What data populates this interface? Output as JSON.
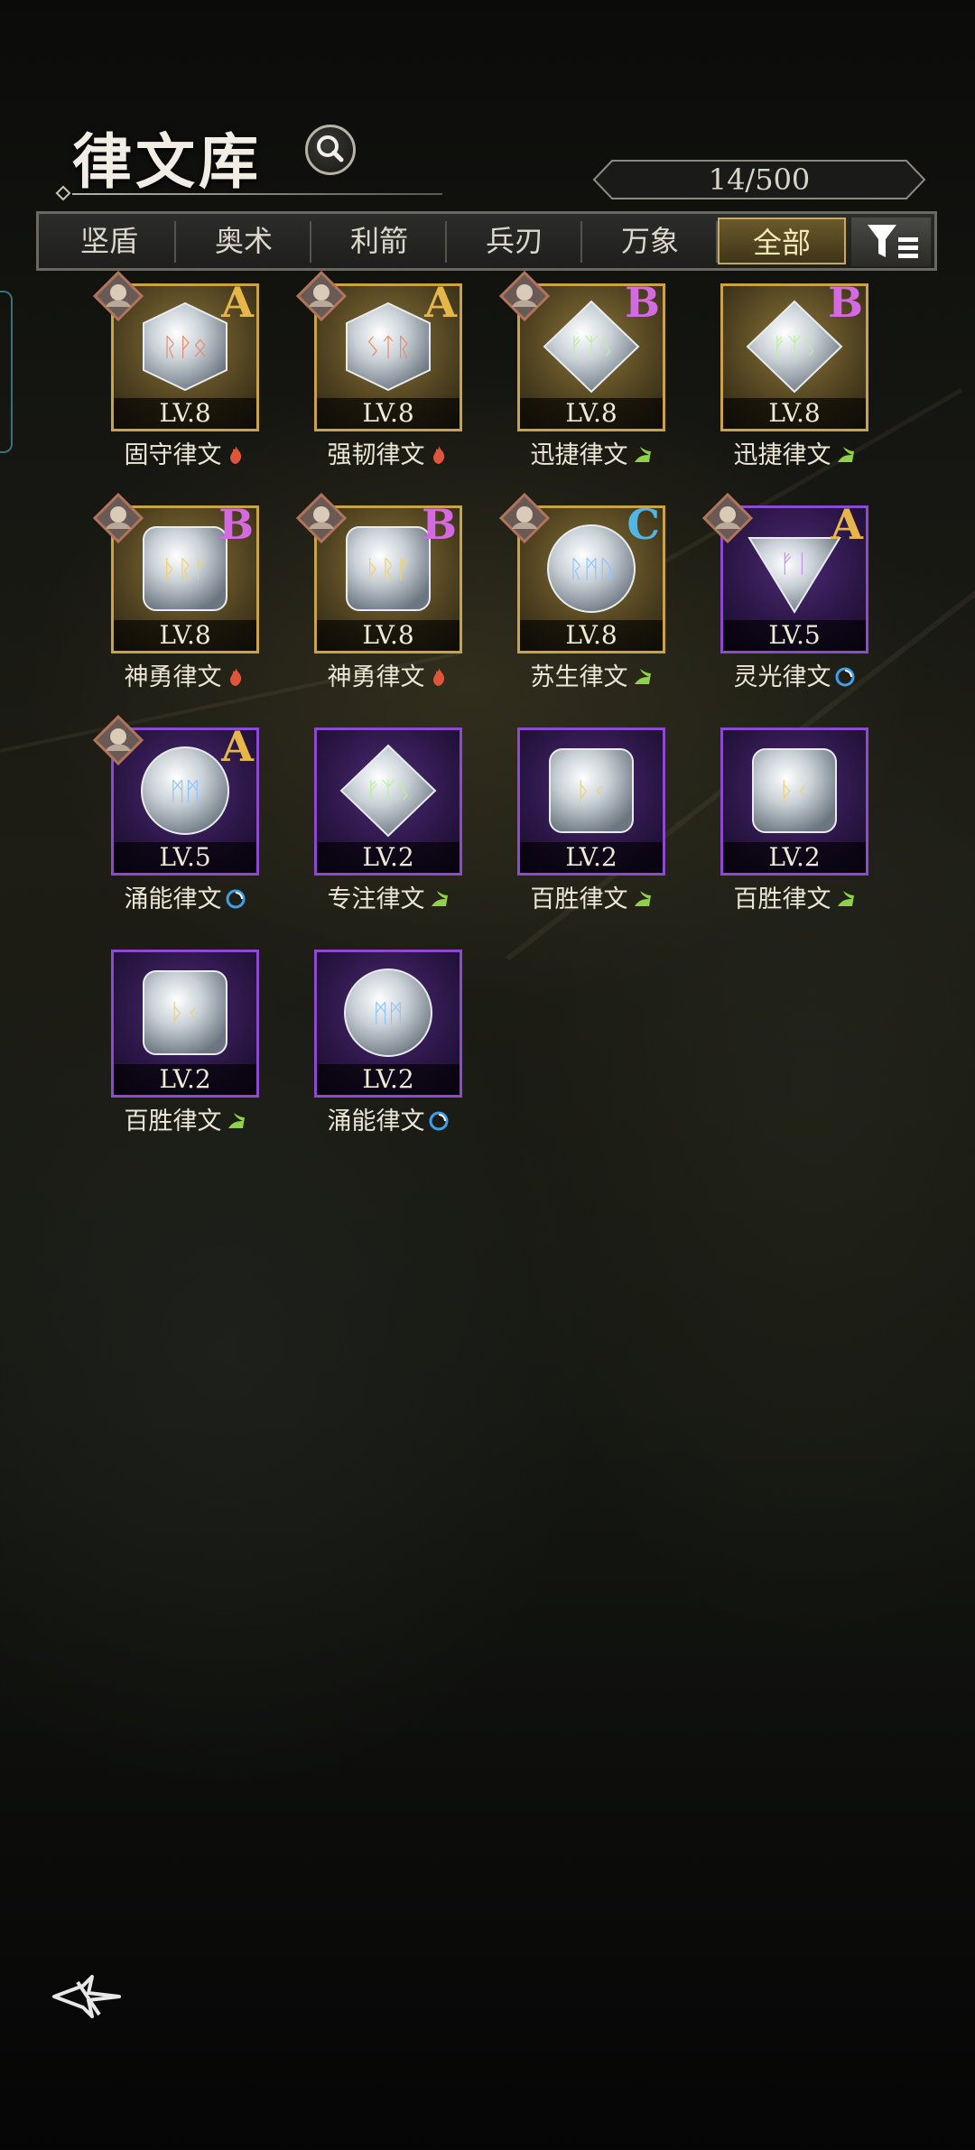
{
  "header": {
    "title": "律文库",
    "capacity": "14/500"
  },
  "tabs": [
    {
      "label": "坚盾",
      "active": false
    },
    {
      "label": "奥术",
      "active": false
    },
    {
      "label": "利箭",
      "active": false
    },
    {
      "label": "兵刃",
      "active": false
    },
    {
      "label": "万象",
      "active": false
    },
    {
      "label": "全部",
      "active": true
    }
  ],
  "colors": {
    "gold_frame": "#caa24a",
    "purple_frame": "#8d4ad0",
    "grade_A": "#e6b64a",
    "grade_B": "#d36ae0",
    "grade_C": "#4fb6e6",
    "fire": "#e0553a",
    "wind": "#8fd14a",
    "water": "#3ea0e8"
  },
  "items": [
    {
      "name": "固守律文",
      "level": "LV.8",
      "grade": "A",
      "rune": "ᚱᚹᛟ",
      "element": "fire-icon",
      "frame": "gold",
      "gem": "hexagon",
      "runeColor": "#e88a6a",
      "badge": true
    },
    {
      "name": "强韧律文",
      "level": "LV.8",
      "grade": "A",
      "rune": "ᛊᛏᚱ",
      "element": "fire-icon",
      "frame": "gold",
      "gem": "hexagon",
      "runeColor": "#e88a6a",
      "badge": true
    },
    {
      "name": "迅捷律文",
      "level": "LV.8",
      "grade": "B",
      "rune": "ᚠᛉᛊ",
      "element": "wind-icon",
      "frame": "gold",
      "gem": "diamond",
      "runeColor": "#b8f0a0",
      "badge": true
    },
    {
      "name": "迅捷律文",
      "level": "LV.8",
      "grade": "B",
      "rune": "ᚠᛉᛊ",
      "element": "wind-icon",
      "frame": "gold",
      "gem": "diamond",
      "runeColor": "#b8f0a0",
      "badge": false
    },
    {
      "name": "神勇律文",
      "level": "LV.8",
      "grade": "B",
      "rune": "ᚦᚱᚠ",
      "element": "fire-icon",
      "frame": "gold",
      "gem": "square",
      "runeColor": "#f0d070",
      "badge": true
    },
    {
      "name": "神勇律文",
      "level": "LV.8",
      "grade": "B",
      "rune": "ᚦᚱᚠ",
      "element": "fire-icon",
      "frame": "gold",
      "gem": "square",
      "runeColor": "#f0d070",
      "badge": true
    },
    {
      "name": "苏生律文",
      "level": "LV.8",
      "grade": "C",
      "rune": "ᚱᛗᚢ",
      "element": "wind-icon",
      "frame": "gold",
      "gem": "circle",
      "runeColor": "#8ec4ff",
      "badge": true
    },
    {
      "name": "灵光律文",
      "level": "LV.5",
      "grade": "A",
      "rune": "ᚠᛁ",
      "element": "water-icon",
      "frame": "purple",
      "gem": "triangle",
      "runeColor": "#c88cff",
      "badge": true
    },
    {
      "name": "涌能律文",
      "level": "LV.5",
      "grade": "A",
      "rune": "ᛗᛗ",
      "element": "water-icon",
      "frame": "purple",
      "gem": "circle",
      "runeColor": "#8ec4ff",
      "badge": true
    },
    {
      "name": "专注律文",
      "level": "LV.2",
      "grade": "",
      "rune": "ᚠᛉᛊ",
      "element": "wind-icon",
      "frame": "purple",
      "gem": "diamond",
      "runeColor": "#b8f0a0",
      "badge": false
    },
    {
      "name": "百胜律文",
      "level": "LV.2",
      "grade": "",
      "rune": "ᚦᚲ",
      "element": "wind-icon",
      "frame": "purple",
      "gem": "square",
      "runeColor": "#f0d070",
      "badge": false
    },
    {
      "name": "百胜律文",
      "level": "LV.2",
      "grade": "",
      "rune": "ᚦᚲ",
      "element": "wind-icon",
      "frame": "purple",
      "gem": "square",
      "runeColor": "#f0d070",
      "badge": false
    },
    {
      "name": "百胜律文",
      "level": "LV.2",
      "grade": "",
      "rune": "ᚦᚲ",
      "element": "wind-icon",
      "frame": "purple",
      "gem": "square",
      "runeColor": "#f0d070",
      "badge": false
    },
    {
      "name": "涌能律文",
      "level": "LV.2",
      "grade": "",
      "rune": "ᛗᛗ",
      "element": "water-icon",
      "frame": "purple",
      "gem": "circle",
      "runeColor": "#8ec4ff",
      "badge": false
    }
  ]
}
